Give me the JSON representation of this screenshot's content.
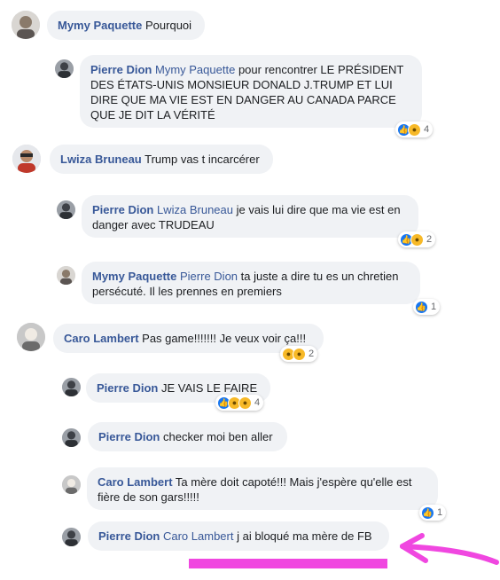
{
  "colors": {
    "author": "#385898",
    "bubble": "#f0f2f5",
    "like": "#1877f2",
    "annotation": "#f047e0"
  },
  "comments": [
    {
      "author": "Mymy Paquette",
      "mention": "",
      "text": "Pourquoi",
      "reactions": [],
      "count": ""
    },
    {
      "author": "Pierre Dion",
      "mention": "Mymy Paquette",
      "text": "pour rencontrer LE PRÉSIDENT DES ÉTATS-UNIS MONSIEUR DONALD J.TRUMP ET LUI DIRE QUE MA VIE EST EN DANGER AU CANADA PARCE QUE JE DIT LA VÉRITÉ",
      "reactions": [
        "like-icon",
        "wow-icon"
      ],
      "count": "4"
    },
    {
      "author": "Lwiza Bruneau",
      "mention": "",
      "text": "Trump vas t incarcérer",
      "reactions": [],
      "count": ""
    },
    {
      "author": "Pierre Dion",
      "mention": "Lwiza Bruneau",
      "text": "je vais lui dire que ma vie est en danger avec TRUDEAU",
      "reactions": [
        "like-icon",
        "haha-icon"
      ],
      "count": "2"
    },
    {
      "author": "Mymy Paquette",
      "mention": "Pierre Dion",
      "text": "ta juste a dire tu es un chretien persécuté. Il les prennes en premiers",
      "reactions": [
        "like-icon"
      ],
      "count": "1"
    },
    {
      "author": "Caro Lambert",
      "mention": "",
      "text": "Pas game!!!!!!! Je veux voir ça!!!",
      "reactions": [
        "haha-icon",
        "sad-icon"
      ],
      "count": "2"
    },
    {
      "author": "Pierre Dion",
      "mention": "",
      "text": "JE VAIS LE FAIRE",
      "reactions": [
        "like-icon",
        "wow-icon",
        "sad-icon"
      ],
      "count": "4"
    },
    {
      "author": "Pierre Dion",
      "mention": "",
      "text": "checker moi ben aller",
      "reactions": [],
      "count": ""
    },
    {
      "author": "Caro Lambert",
      "mention": "",
      "text": "Ta mère doit capoté!!! Mais j'espère qu'elle est fière de son gars!!!!!",
      "reactions": [
        "like-icon"
      ],
      "count": "1"
    },
    {
      "author": "Pierre Dion",
      "mention": "Caro Lambert",
      "text": "j ai bloqué ma mère de FB",
      "reactions": [],
      "count": ""
    }
  ]
}
